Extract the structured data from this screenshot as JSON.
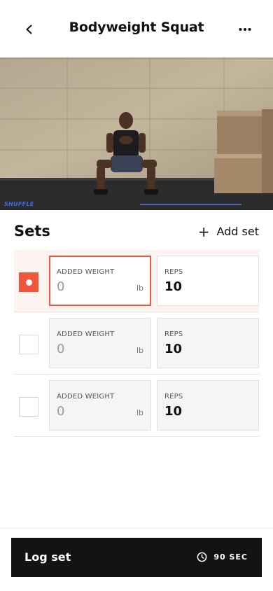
{
  "header": {
    "title": "Bodyweight Squat",
    "back_icon": "chevron-left-icon",
    "more_icon": "more-horizontal-icon"
  },
  "video": {
    "watermark": "SHUFFLE"
  },
  "sets_section": {
    "title": "Sets",
    "add_label": "Add set",
    "add_icon": "plus-icon"
  },
  "sets": [
    {
      "checked": true,
      "weight_label": "ADDED WEIGHT",
      "weight_value": "0",
      "weight_unit": "lb",
      "reps_label": "REPS",
      "reps_value": "10"
    },
    {
      "checked": false,
      "weight_label": "ADDED WEIGHT",
      "weight_value": "0",
      "weight_unit": "lb",
      "reps_label": "REPS",
      "reps_value": "10"
    },
    {
      "checked": false,
      "weight_label": "ADDED WEIGHT",
      "weight_value": "0",
      "weight_unit": "lb",
      "reps_label": "REPS",
      "reps_value": "10"
    }
  ],
  "footer": {
    "log_label": "Log set",
    "timer_label": "90 SEC",
    "timer_icon": "clock-icon"
  },
  "colors": {
    "accent": "#f0573a",
    "button_bg": "#131313"
  }
}
